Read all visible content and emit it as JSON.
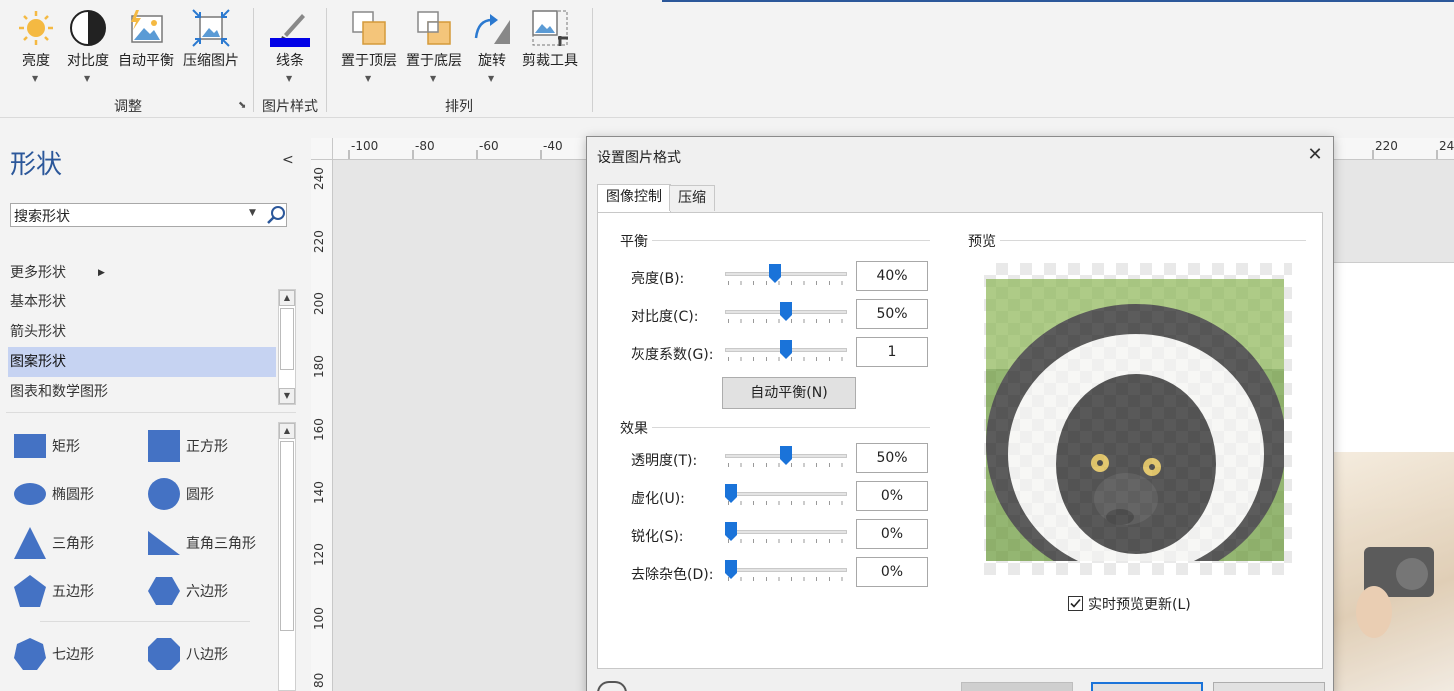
{
  "ribbon": {
    "buttons": [
      {
        "label": "亮度",
        "icon": "brightness-icon"
      },
      {
        "label": "对比度",
        "icon": "contrast-icon"
      },
      {
        "label": "自动平衡",
        "icon": "auto-balance-icon"
      },
      {
        "label": "压缩图片",
        "icon": "compress-picture-icon"
      },
      {
        "label": "线条",
        "icon": "line-color-icon"
      },
      {
        "label": "置于顶层",
        "icon": "bring-to-front-icon"
      },
      {
        "label": "置于底层",
        "icon": "send-to-back-icon"
      },
      {
        "label": "旋转",
        "icon": "rotate-icon"
      },
      {
        "label": "剪裁工具",
        "icon": "crop-tool-icon"
      }
    ],
    "groups": {
      "adjust": "调整",
      "picture_style": "图片样式",
      "arrange": "排列"
    },
    "line_color": "#0000e6"
  },
  "shapes_pane": {
    "title": "形状",
    "search_placeholder": "搜索形状",
    "more_shapes": "更多形状",
    "stencils": [
      "基本形状",
      "箭头形状",
      "图案形状",
      "图表和数学图形"
    ],
    "selected_stencil": "图案形状",
    "shape_color": "#4472c4",
    "shapes": [
      "矩形",
      "正方形",
      "椭圆形",
      "圆形",
      "三角形",
      "直角三角形",
      "五边形",
      "六边形",
      "七边形",
      "八边形"
    ]
  },
  "rulers": {
    "horizontal": [
      "-100",
      "-80",
      "-60",
      "-40",
      "220",
      "24"
    ],
    "vertical": [
      "240",
      "220",
      "200",
      "180",
      "160",
      "140",
      "120",
      "100",
      "80"
    ]
  },
  "dialog": {
    "title": "设置图片格式",
    "tabs": [
      "图像控制",
      "压缩"
    ],
    "balance_section": "平衡",
    "effects_section": "效果",
    "preview_section": "预览",
    "auto_balance_button": "自动平衡(N)",
    "live_preview": "实时预览更新(L)",
    "live_preview_checked": true,
    "controls": {
      "brightness": {
        "label": "亮度(B):",
        "value": "40%",
        "level": 0.4
      },
      "contrast": {
        "label": "对比度(C):",
        "value": "50%",
        "level": 0.5
      },
      "gamma": {
        "label": "灰度系数(G):",
        "value": "1",
        "level": 0.5
      },
      "transparency": {
        "label": "透明度(T):",
        "value": "50%",
        "level": 0.5
      },
      "blur": {
        "label": "虚化(U):",
        "value": "0%",
        "level": 0
      },
      "sharpen": {
        "label": "锐化(S):",
        "value": "0%",
        "level": 0
      },
      "denoise": {
        "label": "去除杂色(D):",
        "value": "0%",
        "level": 0
      }
    }
  }
}
